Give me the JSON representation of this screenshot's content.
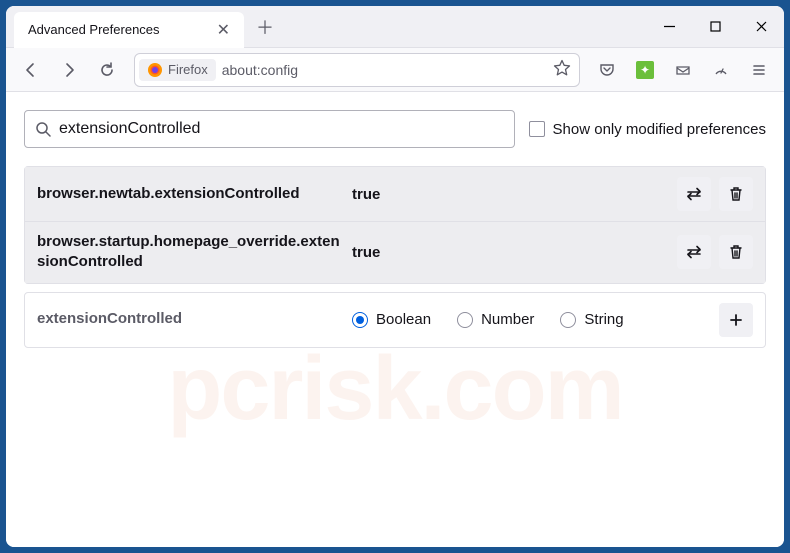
{
  "window": {
    "tab_title": "Advanced Preferences"
  },
  "toolbar": {
    "identity_label": "Firefox",
    "url": "about:config"
  },
  "search": {
    "value": "extensionControlled",
    "checkbox_label": "Show only modified preferences"
  },
  "prefs": [
    {
      "name": "browser.newtab.extensionControlled",
      "value": "true"
    },
    {
      "name": "browser.startup.homepage_override.extensionControlled",
      "value": "true"
    }
  ],
  "new_pref": {
    "name": "extensionControlled",
    "types": {
      "boolean": "Boolean",
      "number": "Number",
      "string": "String"
    }
  },
  "watermark": "pcrisk.com"
}
